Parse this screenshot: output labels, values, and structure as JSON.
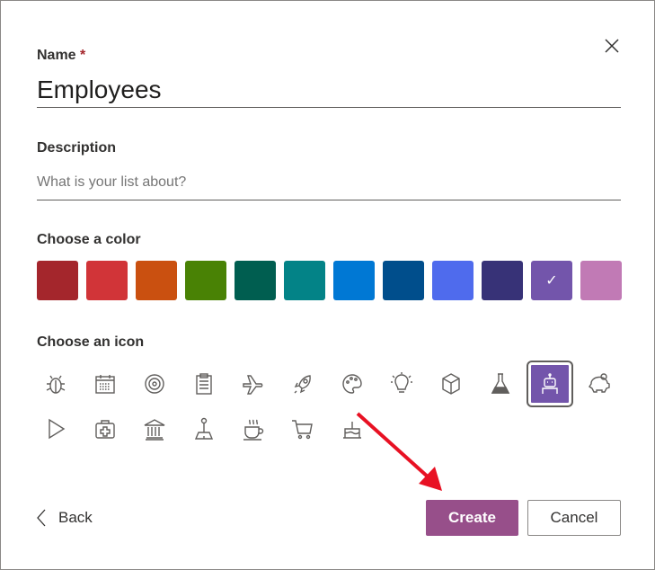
{
  "name": {
    "label": "Name",
    "required_mark": "*",
    "value": "Employees"
  },
  "description": {
    "label": "Description",
    "placeholder": "What is your list about?"
  },
  "color": {
    "label": "Choose a color",
    "swatches": [
      "#a4262c",
      "#d13438",
      "#ca5010",
      "#498205",
      "#005e50",
      "#038387",
      "#0078d4",
      "#004e8c",
      "#4f6bed",
      "#373277",
      "#7355ab",
      "#c17ab5"
    ],
    "selected_index": 10,
    "check": "✓"
  },
  "icon": {
    "label": "Choose an icon",
    "items": [
      "bug",
      "calendar",
      "target",
      "clipboard",
      "airplane",
      "rocket",
      "palette",
      "lightbulb",
      "cube",
      "beaker",
      "robot",
      "piggy-bank",
      "play",
      "medical-kit",
      "bank",
      "joystick",
      "coffee",
      "shopping-cart",
      "cake"
    ],
    "selected": "robot"
  },
  "footer": {
    "back": "Back",
    "create": "Create",
    "cancel": "Cancel"
  },
  "annotation_color": "#e81123"
}
